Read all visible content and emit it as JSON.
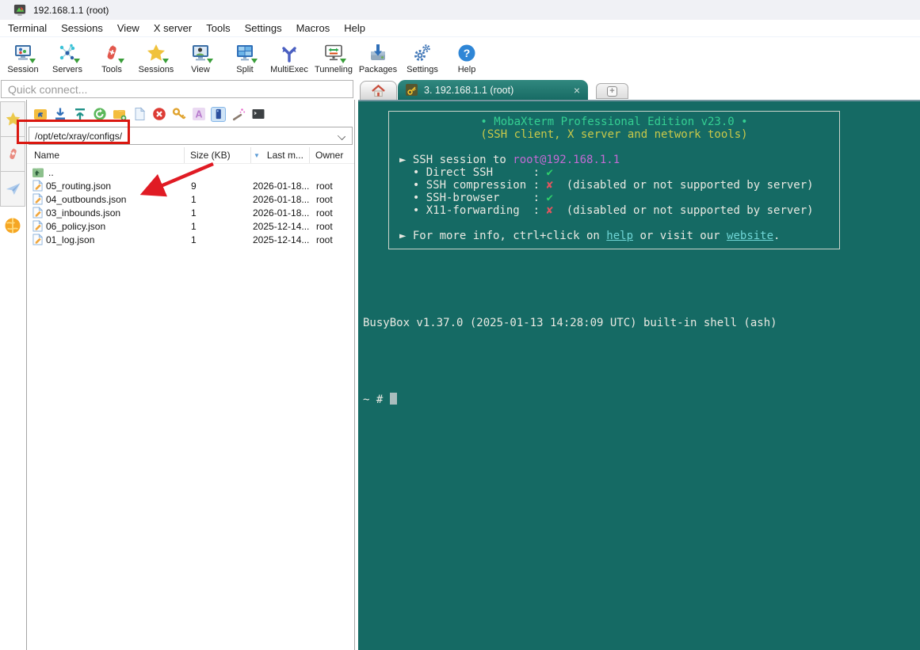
{
  "titlebar": {
    "title": "192.168.1.1 (root)"
  },
  "menubar": {
    "items": [
      "Terminal",
      "Sessions",
      "View",
      "X server",
      "Tools",
      "Settings",
      "Macros",
      "Help"
    ]
  },
  "toolbar": {
    "items": [
      {
        "label": "Session"
      },
      {
        "label": "Servers"
      },
      {
        "label": "Tools"
      },
      {
        "label": "Sessions"
      },
      {
        "label": "View"
      },
      {
        "label": "Split"
      },
      {
        "label": "MultiExec"
      },
      {
        "label": "Tunneling"
      },
      {
        "label": "Packages"
      },
      {
        "label": "Settings"
      },
      {
        "label": "Help"
      }
    ]
  },
  "quick_connect": {
    "placeholder": "Quick connect..."
  },
  "tabbar": {
    "active_tab": {
      "label": "3. 192.168.1.1 (root)",
      "close": "×"
    },
    "new_tab": "+"
  },
  "sftp": {
    "path": "/opt/etc/xray/configs/",
    "columns": {
      "name": "Name",
      "size": "Size (KB)",
      "sort_indicator": "▼",
      "modified": "Last m...",
      "owner": "Owner"
    },
    "parent": "..",
    "files": [
      {
        "name": "05_routing.json",
        "size": "9",
        "modified": "2026-01-18...",
        "owner": "root"
      },
      {
        "name": "04_outbounds.json",
        "size": "1",
        "modified": "2026-01-18...",
        "owner": "root"
      },
      {
        "name": "03_inbounds.json",
        "size": "1",
        "modified": "2026-01-18...",
        "owner": "root"
      },
      {
        "name": "06_policy.json",
        "size": "1",
        "modified": "2025-12-14...",
        "owner": "root"
      },
      {
        "name": "01_log.json",
        "size": "1",
        "modified": "2025-12-14...",
        "owner": "root"
      }
    ]
  },
  "terminal": {
    "banner_title": "• MobaXterm Professional Edition v23.0 •",
    "banner_subtitle": "(SSH client, X server and network tools)",
    "session_prefix": "► SSH session to ",
    "session_target": "root@192.168.1.1",
    "statuses": [
      {
        "label": "  • Direct SSH      : ",
        "mark": "✔",
        "note": ""
      },
      {
        "label": "  • SSH compression : ",
        "mark": "✘",
        "note": "  (disabled or not supported by server)"
      },
      {
        "label": "  • SSH-browser     : ",
        "mark": "✔",
        "note": ""
      },
      {
        "label": "  • X11-forwarding  : ",
        "mark": "✘",
        "note": "  (disabled or not supported by server)"
      }
    ],
    "info_prefix": "► For more info, ctrl+click on ",
    "help_link": "help",
    "info_middle": " or visit our ",
    "website_link": "website",
    "info_suffix": ".",
    "busybox_line": "BusyBox v1.37.0 (2025-01-13 14:28:09 UTC) built-in shell (ash)",
    "prompt": "~ # "
  },
  "colors": {
    "terminal_bg": "#156a64",
    "banner_green": "#35cf92",
    "banner_yellow": "#c9c94a",
    "session_magenta": "#c36bd3",
    "link_cyan": "#6fd6d6",
    "ok_green": "#2fd06a",
    "fail_red": "#e0555f",
    "annotation_red": "#da1710"
  }
}
